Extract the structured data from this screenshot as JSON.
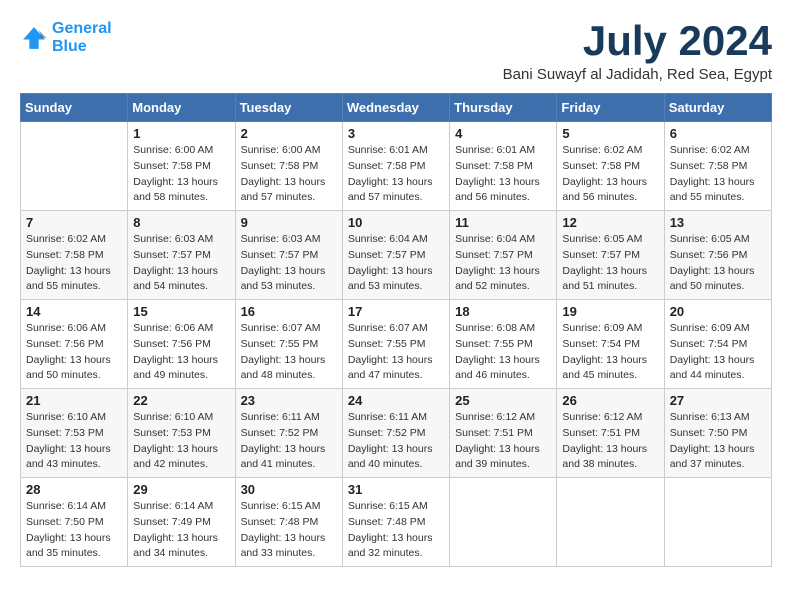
{
  "header": {
    "logo_line1": "General",
    "logo_line2": "Blue",
    "month_title": "July 2024",
    "location": "Bani Suwayf al Jadidah, Red Sea, Egypt"
  },
  "weekdays": [
    "Sunday",
    "Monday",
    "Tuesday",
    "Wednesday",
    "Thursday",
    "Friday",
    "Saturday"
  ],
  "weeks": [
    [
      {
        "day": "",
        "sunrise": "",
        "sunset": "",
        "daylight": ""
      },
      {
        "day": "1",
        "sunrise": "Sunrise: 6:00 AM",
        "sunset": "Sunset: 7:58 PM",
        "daylight": "Daylight: 13 hours and 58 minutes."
      },
      {
        "day": "2",
        "sunrise": "Sunrise: 6:00 AM",
        "sunset": "Sunset: 7:58 PM",
        "daylight": "Daylight: 13 hours and 57 minutes."
      },
      {
        "day": "3",
        "sunrise": "Sunrise: 6:01 AM",
        "sunset": "Sunset: 7:58 PM",
        "daylight": "Daylight: 13 hours and 57 minutes."
      },
      {
        "day": "4",
        "sunrise": "Sunrise: 6:01 AM",
        "sunset": "Sunset: 7:58 PM",
        "daylight": "Daylight: 13 hours and 56 minutes."
      },
      {
        "day": "5",
        "sunrise": "Sunrise: 6:02 AM",
        "sunset": "Sunset: 7:58 PM",
        "daylight": "Daylight: 13 hours and 56 minutes."
      },
      {
        "day": "6",
        "sunrise": "Sunrise: 6:02 AM",
        "sunset": "Sunset: 7:58 PM",
        "daylight": "Daylight: 13 hours and 55 minutes."
      }
    ],
    [
      {
        "day": "7",
        "sunrise": "Sunrise: 6:02 AM",
        "sunset": "Sunset: 7:58 PM",
        "daylight": "Daylight: 13 hours and 55 minutes."
      },
      {
        "day": "8",
        "sunrise": "Sunrise: 6:03 AM",
        "sunset": "Sunset: 7:57 PM",
        "daylight": "Daylight: 13 hours and 54 minutes."
      },
      {
        "day": "9",
        "sunrise": "Sunrise: 6:03 AM",
        "sunset": "Sunset: 7:57 PM",
        "daylight": "Daylight: 13 hours and 53 minutes."
      },
      {
        "day": "10",
        "sunrise": "Sunrise: 6:04 AM",
        "sunset": "Sunset: 7:57 PM",
        "daylight": "Daylight: 13 hours and 53 minutes."
      },
      {
        "day": "11",
        "sunrise": "Sunrise: 6:04 AM",
        "sunset": "Sunset: 7:57 PM",
        "daylight": "Daylight: 13 hours and 52 minutes."
      },
      {
        "day": "12",
        "sunrise": "Sunrise: 6:05 AM",
        "sunset": "Sunset: 7:57 PM",
        "daylight": "Daylight: 13 hours and 51 minutes."
      },
      {
        "day": "13",
        "sunrise": "Sunrise: 6:05 AM",
        "sunset": "Sunset: 7:56 PM",
        "daylight": "Daylight: 13 hours and 50 minutes."
      }
    ],
    [
      {
        "day": "14",
        "sunrise": "Sunrise: 6:06 AM",
        "sunset": "Sunset: 7:56 PM",
        "daylight": "Daylight: 13 hours and 50 minutes."
      },
      {
        "day": "15",
        "sunrise": "Sunrise: 6:06 AM",
        "sunset": "Sunset: 7:56 PM",
        "daylight": "Daylight: 13 hours and 49 minutes."
      },
      {
        "day": "16",
        "sunrise": "Sunrise: 6:07 AM",
        "sunset": "Sunset: 7:55 PM",
        "daylight": "Daylight: 13 hours and 48 minutes."
      },
      {
        "day": "17",
        "sunrise": "Sunrise: 6:07 AM",
        "sunset": "Sunset: 7:55 PM",
        "daylight": "Daylight: 13 hours and 47 minutes."
      },
      {
        "day": "18",
        "sunrise": "Sunrise: 6:08 AM",
        "sunset": "Sunset: 7:55 PM",
        "daylight": "Daylight: 13 hours and 46 minutes."
      },
      {
        "day": "19",
        "sunrise": "Sunrise: 6:09 AM",
        "sunset": "Sunset: 7:54 PM",
        "daylight": "Daylight: 13 hours and 45 minutes."
      },
      {
        "day": "20",
        "sunrise": "Sunrise: 6:09 AM",
        "sunset": "Sunset: 7:54 PM",
        "daylight": "Daylight: 13 hours and 44 minutes."
      }
    ],
    [
      {
        "day": "21",
        "sunrise": "Sunrise: 6:10 AM",
        "sunset": "Sunset: 7:53 PM",
        "daylight": "Daylight: 13 hours and 43 minutes."
      },
      {
        "day": "22",
        "sunrise": "Sunrise: 6:10 AM",
        "sunset": "Sunset: 7:53 PM",
        "daylight": "Daylight: 13 hours and 42 minutes."
      },
      {
        "day": "23",
        "sunrise": "Sunrise: 6:11 AM",
        "sunset": "Sunset: 7:52 PM",
        "daylight": "Daylight: 13 hours and 41 minutes."
      },
      {
        "day": "24",
        "sunrise": "Sunrise: 6:11 AM",
        "sunset": "Sunset: 7:52 PM",
        "daylight": "Daylight: 13 hours and 40 minutes."
      },
      {
        "day": "25",
        "sunrise": "Sunrise: 6:12 AM",
        "sunset": "Sunset: 7:51 PM",
        "daylight": "Daylight: 13 hours and 39 minutes."
      },
      {
        "day": "26",
        "sunrise": "Sunrise: 6:12 AM",
        "sunset": "Sunset: 7:51 PM",
        "daylight": "Daylight: 13 hours and 38 minutes."
      },
      {
        "day": "27",
        "sunrise": "Sunrise: 6:13 AM",
        "sunset": "Sunset: 7:50 PM",
        "daylight": "Daylight: 13 hours and 37 minutes."
      }
    ],
    [
      {
        "day": "28",
        "sunrise": "Sunrise: 6:14 AM",
        "sunset": "Sunset: 7:50 PM",
        "daylight": "Daylight: 13 hours and 35 minutes."
      },
      {
        "day": "29",
        "sunrise": "Sunrise: 6:14 AM",
        "sunset": "Sunset: 7:49 PM",
        "daylight": "Daylight: 13 hours and 34 minutes."
      },
      {
        "day": "30",
        "sunrise": "Sunrise: 6:15 AM",
        "sunset": "Sunset: 7:48 PM",
        "daylight": "Daylight: 13 hours and 33 minutes."
      },
      {
        "day": "31",
        "sunrise": "Sunrise: 6:15 AM",
        "sunset": "Sunset: 7:48 PM",
        "daylight": "Daylight: 13 hours and 32 minutes."
      },
      {
        "day": "",
        "sunrise": "",
        "sunset": "",
        "daylight": ""
      },
      {
        "day": "",
        "sunrise": "",
        "sunset": "",
        "daylight": ""
      },
      {
        "day": "",
        "sunrise": "",
        "sunset": "",
        "daylight": ""
      }
    ]
  ]
}
